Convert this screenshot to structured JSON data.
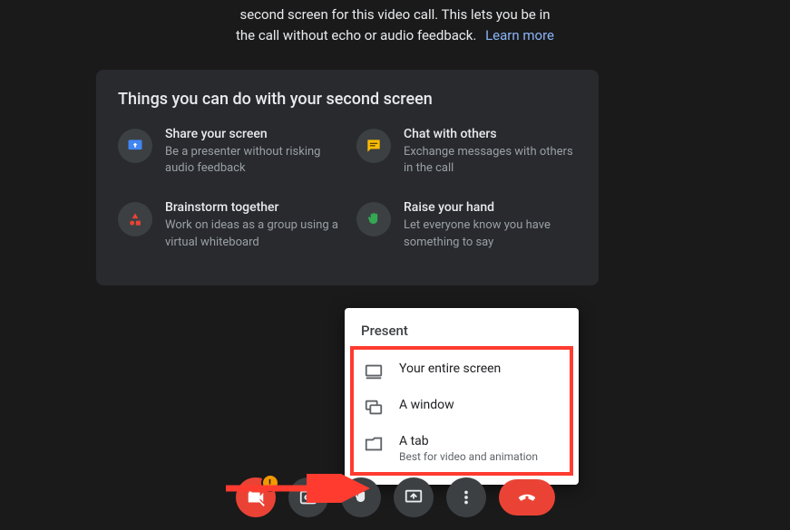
{
  "banner": {
    "line1": "second screen for this video call. This lets you be in",
    "line2": "the call without echo or audio feedback.",
    "learn_more": "Learn more"
  },
  "card": {
    "title": "Things you can do with your second screen",
    "items": [
      {
        "title": "Share your screen",
        "desc": "Be a presenter without risking audio feedback"
      },
      {
        "title": "Chat with others",
        "desc": "Exchange messages with others in the call"
      },
      {
        "title": "Brainstorm together",
        "desc": "Work on ideas as a group using a virtual whiteboard"
      },
      {
        "title": "Raise your hand",
        "desc": "Let everyone know you have something to say"
      }
    ]
  },
  "present_popup": {
    "title": "Present",
    "options": [
      {
        "label": "Your entire screen",
        "sub": ""
      },
      {
        "label": "A window",
        "sub": ""
      },
      {
        "label": "A tab",
        "sub": "Best for video and animation"
      }
    ]
  },
  "toolbar": {
    "camera_badge": "!",
    "buttons": {
      "camera": "camera-off",
      "captions": "closed-captions",
      "raise_hand": "raise-hand",
      "present": "present-screen",
      "more": "more-options",
      "end": "end-call"
    }
  }
}
